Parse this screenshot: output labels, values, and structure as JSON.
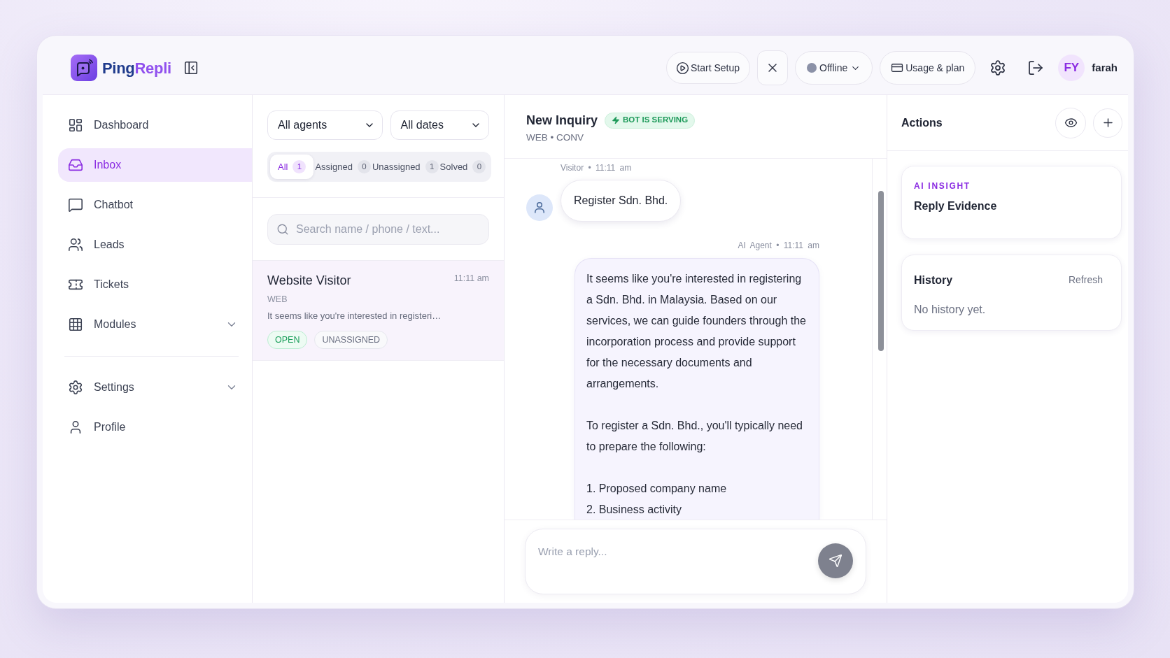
{
  "brand": {
    "name_parts": [
      "Ping",
      "Repli"
    ]
  },
  "top_bar": {
    "setup_button": "Start Setup",
    "status": {
      "label": "Offline",
      "online": false
    },
    "usage_button": "Usage & plan",
    "user": {
      "initials": "FY",
      "name": "farah"
    }
  },
  "sidebar": {
    "items": [
      {
        "label": "Dashboard",
        "selected": false
      },
      {
        "label": "Inbox",
        "selected": true
      },
      {
        "label": "Chatbot",
        "selected": false
      },
      {
        "label": "Leads",
        "selected": false
      },
      {
        "label": "Tickets",
        "selected": false
      },
      {
        "label": "Modules",
        "selected": false,
        "expanded": false
      }
    ],
    "secondary_items": [
      {
        "label": "Settings",
        "selected": false,
        "expanded": false
      },
      {
        "label": "Profile",
        "selected": false
      }
    ]
  },
  "inbox": {
    "filters": {
      "agent": "All agents",
      "date": "All dates"
    },
    "tabs": [
      {
        "label": "All",
        "count": "1",
        "selected": true
      },
      {
        "label": "Assigned",
        "count": "0",
        "selected": false
      },
      {
        "label": "Unassigned",
        "count": "1",
        "selected": false
      },
      {
        "label": "Solved",
        "count": "0",
        "selected": false
      }
    ],
    "search": {
      "placeholder": "Search name / phone / text..."
    },
    "conversations": [
      {
        "name": "Website Visitor",
        "time": "11:11 am",
        "channel": "WEB",
        "preview": "It seems like you're interested in registeri…",
        "selected": true,
        "tags": [
          {
            "label": "OPEN",
            "kind": "status"
          },
          {
            "label": "UNASSIGNED",
            "kind": "assignment"
          }
        ]
      }
    ]
  },
  "chat": {
    "title": "New Inquiry",
    "badge": "BOT IS SERVING",
    "subtitle": "WEB • CONV",
    "messages": [
      {
        "kind": "visitor",
        "meta": "Visitor • 11:11 am",
        "blocks": [
          {
            "kind": "paragraph",
            "text": "Register Sdn. Bhd."
          }
        ]
      },
      {
        "kind": "agent",
        "meta": "AI Agent • 11:11 am",
        "blocks": [
          {
            "kind": "paragraph",
            "text": "It seems like you're interested in registering a Sdn. Bhd. in Malaysia. Based on our services, we can guide founders through the incorporation process and provide support for the necessary documents and arrangements."
          },
          {
            "kind": "paragraph",
            "text": "To register a Sdn. Bhd., you'll typically need to prepare the following:"
          },
          {
            "kind": "list",
            "items": [
              "1. Proposed company name",
              "2. Business activity"
            ]
          }
        ]
      }
    ],
    "composer": {
      "placeholder": "Write a reply...",
      "send_disabled": true
    }
  },
  "actions_panel": {
    "title": "Actions",
    "insight": {
      "label": "AI INSIGHT",
      "title": "Reply Evidence"
    },
    "history": {
      "title": "History",
      "action": "Refresh",
      "empty_text": "No history yet."
    }
  }
}
